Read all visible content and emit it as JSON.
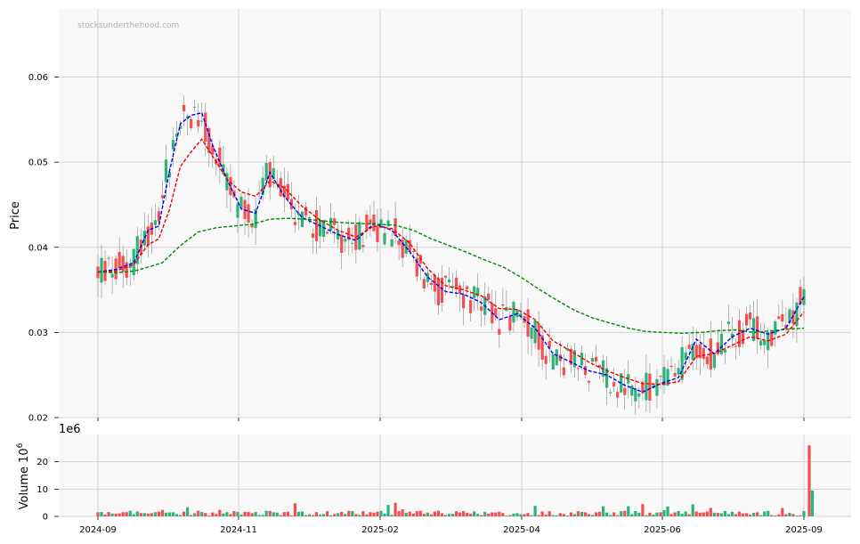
{
  "chart_data": [
    {
      "type": "candlestick",
      "watermark": "stocksunderthehood.com",
      "ylabel": "Price",
      "xlabel": "",
      "ylim": [
        0.02,
        0.068
      ],
      "y_ticks": [
        0.02,
        0.03,
        0.04,
        0.05,
        0.06
      ],
      "y_tick_labels": [
        "0.02",
        "0.03",
        "0.04",
        "0.05",
        "0.06"
      ],
      "x_ticks": [
        "2024-09",
        "2024-11",
        "2025-02",
        "2025-04",
        "2025-06",
        "2025-09"
      ],
      "grid": true,
      "colors": {
        "up": "#2db37a",
        "down": "#f05050",
        "ma_short": "#0000ee",
        "ma_mid": "#ee0000",
        "ma_long": "#008800",
        "background": "#f8f8f8",
        "grid": "#d4d4d4"
      },
      "close_by_month": {
        "2024-09": 0.0372,
        "2024-10": 0.056,
        "2024-11": 0.046,
        "2024-12": 0.042,
        "2025-01": 0.042,
        "2025-02": 0.04,
        "2025-03": 0.034,
        "2025-04": 0.032,
        "2025-05": 0.026,
        "2025-06": 0.024,
        "2025-07": 0.029,
        "2025-08": 0.03,
        "2025-09": 0.034
      },
      "series": [
        {
          "role": "ma_short",
          "points": [
            [
              0,
              0.0371
            ],
            [
              10,
              0.0374
            ],
            [
              20,
              0.0382
            ],
            [
              28,
              0.042
            ],
            [
              34,
              0.0425
            ],
            [
              40,
              0.049
            ],
            [
              46,
              0.0545
            ],
            [
              52,
              0.0555
            ],
            [
              58,
              0.0558
            ],
            [
              64,
              0.052
            ],
            [
              72,
              0.048
            ],
            [
              80,
              0.0445
            ],
            [
              88,
              0.044
            ],
            [
              96,
              0.0488
            ],
            [
              104,
              0.046
            ],
            [
              114,
              0.0435
            ],
            [
              124,
              0.0425
            ],
            [
              134,
              0.0415
            ],
            [
              144,
              0.0408
            ],
            [
              154,
              0.0428
            ],
            [
              164,
              0.042
            ],
            [
              174,
              0.0395
            ],
            [
              184,
              0.0365
            ],
            [
              194,
              0.0348
            ],
            [
              204,
              0.0345
            ],
            [
              214,
              0.0335
            ],
            [
              224,
              0.0315
            ],
            [
              234,
              0.0322
            ],
            [
              244,
              0.0305
            ],
            [
              254,
              0.0275
            ],
            [
              264,
              0.0265
            ],
            [
              274,
              0.0255
            ],
            [
              284,
              0.025
            ],
            [
              294,
              0.0238
            ],
            [
              304,
              0.023
            ],
            [
              314,
              0.024
            ],
            [
              324,
              0.0247
            ],
            [
              334,
              0.0292
            ],
            [
              344,
              0.0275
            ],
            [
              354,
              0.0295
            ],
            [
              364,
              0.0305
            ],
            [
              374,
              0.0298
            ],
            [
              384,
              0.0305
            ],
            [
              394,
              0.0342
            ]
          ]
        },
        {
          "role": "ma_mid",
          "points": [
            [
              0,
              0.0371
            ],
            [
              10,
              0.0372
            ],
            [
              20,
              0.038
            ],
            [
              28,
              0.0403
            ],
            [
              34,
              0.041
            ],
            [
              40,
              0.0445
            ],
            [
              46,
              0.0495
            ],
            [
              52,
              0.0512
            ],
            [
              58,
              0.0527
            ],
            [
              64,
              0.0507
            ],
            [
              72,
              0.048
            ],
            [
              80,
              0.0465
            ],
            [
              88,
              0.046
            ],
            [
              96,
              0.0478
            ],
            [
              104,
              0.047
            ],
            [
              114,
              0.0448
            ],
            [
              124,
              0.0432
            ],
            [
              134,
              0.042
            ],
            [
              144,
              0.0412
            ],
            [
              154,
              0.0425
            ],
            [
              164,
              0.0422
            ],
            [
              174,
              0.0405
            ],
            [
              184,
              0.0375
            ],
            [
              194,
              0.0355
            ],
            [
              204,
              0.035
            ],
            [
              214,
              0.0343
            ],
            [
              224,
              0.0328
            ],
            [
              234,
              0.0327
            ],
            [
              244,
              0.0315
            ],
            [
              254,
              0.029
            ],
            [
              264,
              0.0278
            ],
            [
              274,
              0.0265
            ],
            [
              284,
              0.0255
            ],
            [
              294,
              0.0247
            ],
            [
              304,
              0.024
            ],
            [
              314,
              0.0239
            ],
            [
              324,
              0.0242
            ],
            [
              334,
              0.0272
            ],
            [
              344,
              0.0275
            ],
            [
              354,
              0.0285
            ],
            [
              364,
              0.0295
            ],
            [
              374,
              0.029
            ],
            [
              384,
              0.0298
            ],
            [
              394,
              0.0324
            ]
          ]
        },
        {
          "role": "ma_long",
          "points": [
            [
              0,
              0.0371
            ],
            [
              10,
              0.037
            ],
            [
              20,
              0.0372
            ],
            [
              30,
              0.0378
            ],
            [
              36,
              0.0382
            ],
            [
              46,
              0.0402
            ],
            [
              56,
              0.0418
            ],
            [
              66,
              0.0423
            ],
            [
              76,
              0.0425
            ],
            [
              86,
              0.0427
            ],
            [
              96,
              0.0433
            ],
            [
              106,
              0.0434
            ],
            [
              116,
              0.0433
            ],
            [
              126,
              0.0431
            ],
            [
              136,
              0.0429
            ],
            [
              146,
              0.0428
            ],
            [
              156,
              0.0427
            ],
            [
              166,
              0.0426
            ],
            [
              176,
              0.042
            ],
            [
              186,
              0.041
            ],
            [
              196,
              0.0402
            ],
            [
              206,
              0.0394
            ],
            [
              216,
              0.0385
            ],
            [
              226,
              0.0377
            ],
            [
              236,
              0.0365
            ],
            [
              246,
              0.0351
            ],
            [
              256,
              0.0338
            ],
            [
              266,
              0.0326
            ],
            [
              276,
              0.0317
            ],
            [
              286,
              0.0311
            ],
            [
              296,
              0.0305
            ],
            [
              306,
              0.0301
            ],
            [
              316,
              0.03
            ],
            [
              326,
              0.0299
            ],
            [
              336,
              0.03
            ],
            [
              346,
              0.0302
            ],
            [
              356,
              0.0303
            ],
            [
              366,
              0.03
            ],
            [
              376,
              0.0302
            ],
            [
              386,
              0.0304
            ],
            [
              394,
              0.0305
            ]
          ]
        }
      ]
    },
    {
      "type": "bar",
      "ylabel": "Volume  10",
      "ylabel_sup": "6",
      "offset_label": "1e6",
      "ylim": [
        0,
        30
      ],
      "y_ticks": [
        0,
        10,
        20
      ],
      "y_tick_labels": [
        "0",
        "10",
        "20"
      ],
      "grid": true,
      "highlights": [
        {
          "date": "2025-09",
          "value": 26,
          "direction": "down"
        },
        {
          "date": "2025-09",
          "value": 9.5,
          "direction": "up"
        }
      ]
    }
  ]
}
